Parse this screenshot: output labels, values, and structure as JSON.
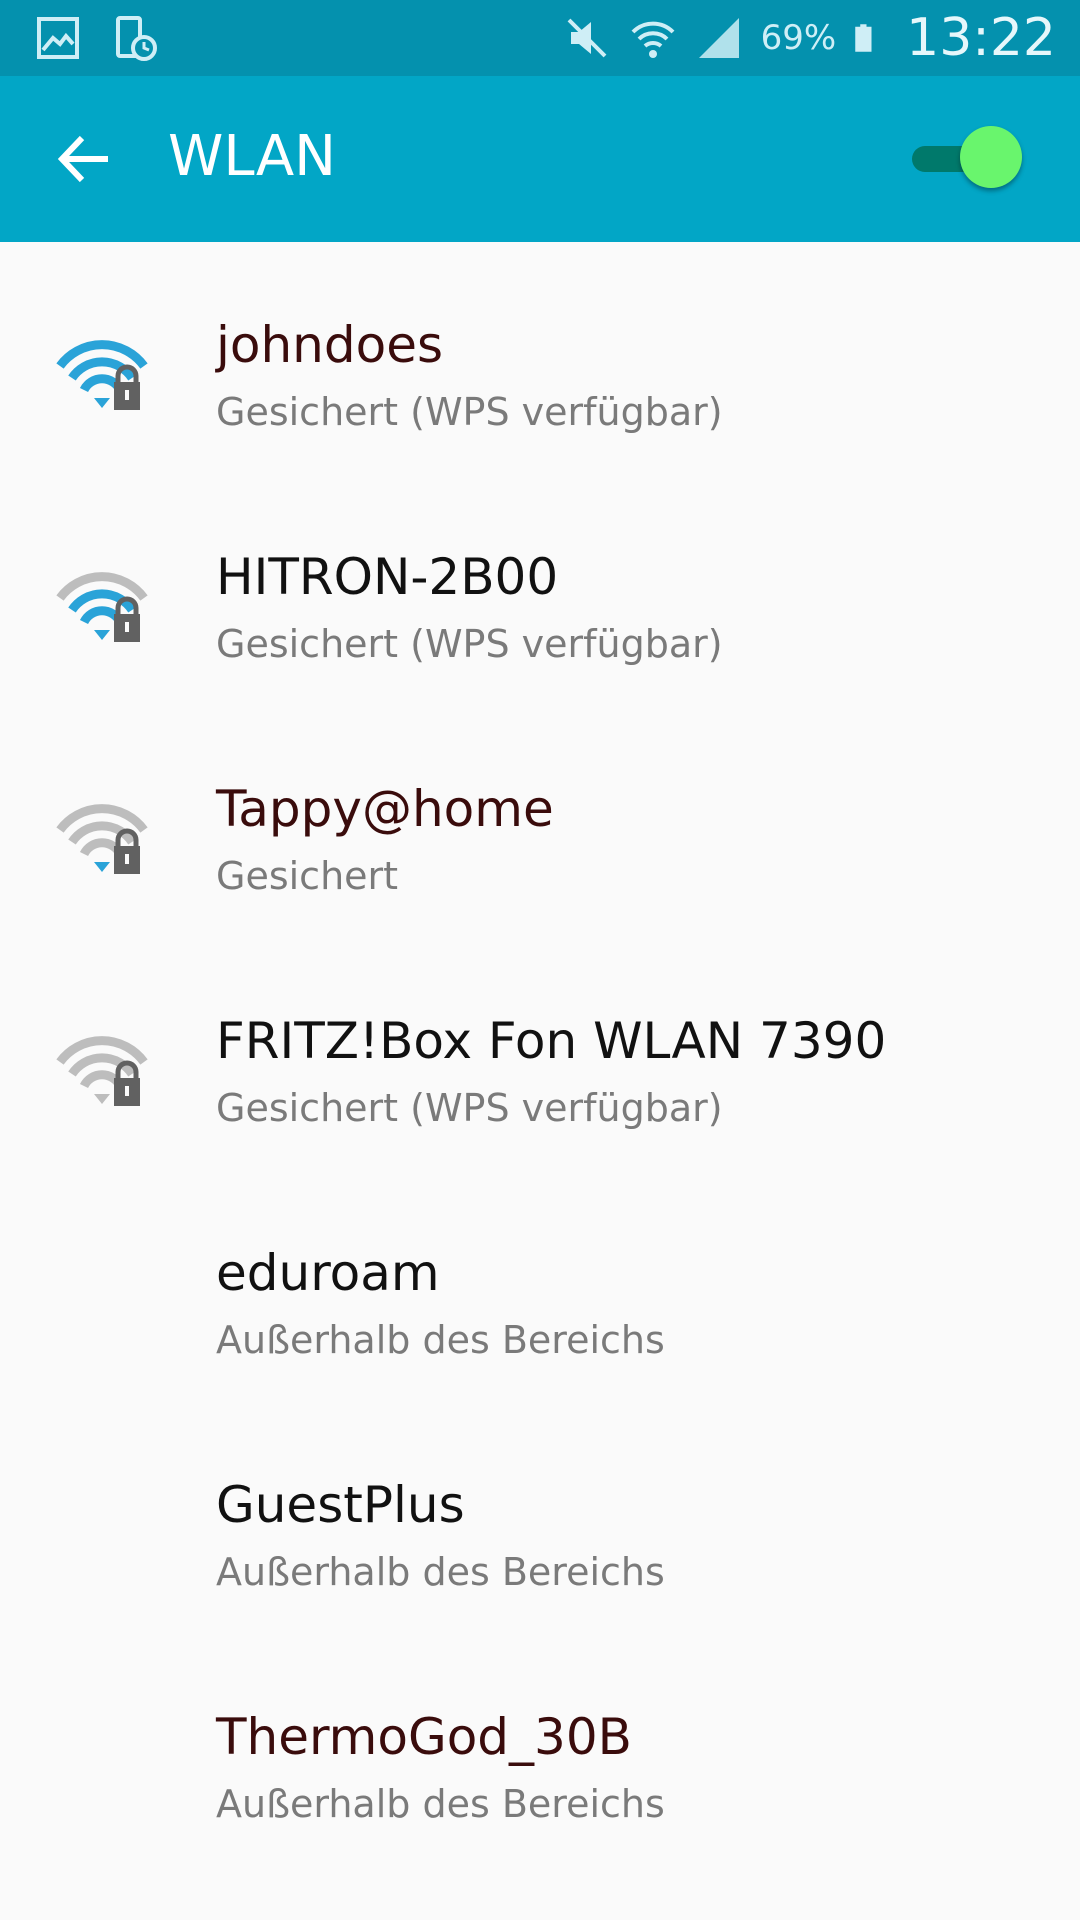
{
  "status_bar": {
    "left_icons": [
      "gallery-icon",
      "device-clock-icon"
    ],
    "right_icons": [
      "mute-icon",
      "wifi-status-icon",
      "cell-signal-icon",
      "battery-icon"
    ],
    "battery_percent": "69%",
    "time": "13:22"
  },
  "toolbar": {
    "back_icon": "arrow-left-icon",
    "title": "WLAN",
    "wifi_enabled": true
  },
  "colors": {
    "status_bar": "#0491ae",
    "toolbar": "#02a6c6",
    "toggle_thumb": "#69f56d",
    "signal_active": "#2aa3d8",
    "signal_inactive": "#bdbdbd"
  },
  "networks": [
    {
      "name": "johndoes",
      "status": "Gesichert (WPS verfügbar)",
      "signal_bars": 4,
      "locked": true
    },
    {
      "name": "HITRON-2B00",
      "status": "Gesichert (WPS verfügbar)",
      "signal_bars": 3,
      "locked": true
    },
    {
      "name": "Tappy@home",
      "status": "Gesichert",
      "signal_bars": 1,
      "locked": true
    },
    {
      "name": "FRITZ!Box Fon WLAN 7390",
      "status": "Gesichert (WPS verfügbar)",
      "signal_bars": 0,
      "locked": true
    },
    {
      "name": "eduroam",
      "status": "Außerhalb des Bereichs",
      "signal_bars": null,
      "locked": false
    },
    {
      "name": "GuestPlus",
      "status": "Außerhalb des Bereichs",
      "signal_bars": null,
      "locked": false
    },
    {
      "name": "ThermoGod_30B",
      "status": "Außerhalb des Bereichs",
      "signal_bars": null,
      "locked": false
    }
  ]
}
